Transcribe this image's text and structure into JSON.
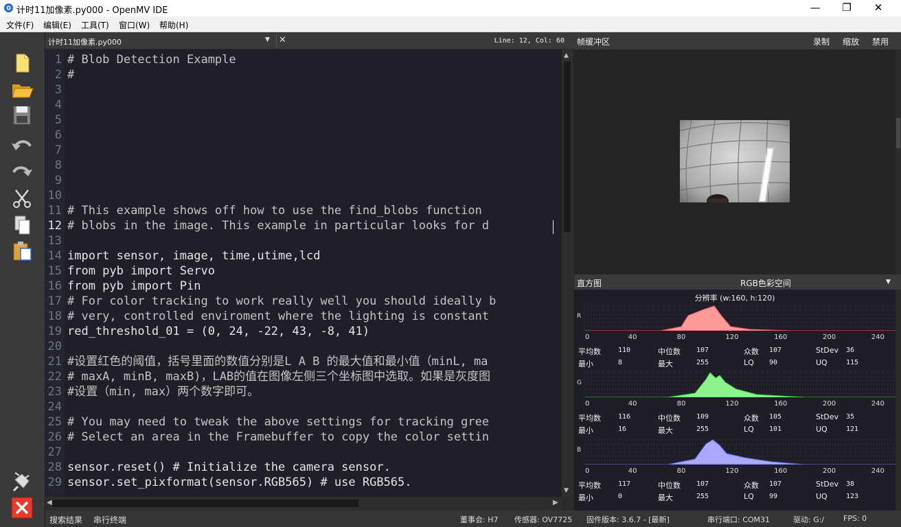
{
  "window": {
    "title": "计时11加像素.py000 - OpenMV IDE",
    "min_glyph": "—",
    "max_glyph": "❐",
    "close_glyph": "✕"
  },
  "menu": [
    "文件(F)",
    "编辑(E)",
    "工具(T)",
    "窗口(W)",
    "帮助(H)"
  ],
  "toolbar": [
    {
      "name": "new-file-icon"
    },
    {
      "name": "open-folder-icon"
    },
    {
      "name": "save-icon"
    },
    {
      "name": "undo-icon"
    },
    {
      "name": "redo-icon"
    },
    {
      "name": "cut-icon"
    },
    {
      "name": "copy-icon"
    },
    {
      "name": "paste-icon"
    },
    {
      "name": "connect-icon"
    },
    {
      "name": "disconnect-icon"
    }
  ],
  "editor": {
    "file_tab": "计时11加像素.py000",
    "position": "Line: 12, Col: 60",
    "current_line": 12,
    "lines": [
      "# Blob Detection Example",
      "#",
      "",
      "",
      "",
      "",
      "",
      "",
      "",
      "",
      "# This example shows off how to use the find_blobs function",
      "# blobs in the image. This example in particular looks for d",
      "",
      "import sensor, image, time,utime,lcd",
      "from pyb import Servo",
      "from pyb import Pin",
      "# For color tracking to work really well you should ideally b",
      "# very, controlled enviroment where the lighting is constant",
      "red_threshold_01 = (0, 24, -22, 43, -8, 41)",
      "",
      "#设置红色的阈值，括号里面的数值分别是L A B 的最大值和最小值（minL, ma",
      "# maxA, minB, maxB)，LAB的值在图像左侧三个坐标图中选取。如果是灰度图",
      "#设置（min, max）两个数字即可。",
      "",
      "# You may need to tweak the above settings for tracking gree",
      "# Select an area in the Framebuffer to copy the color settin",
      "",
      "sensor.reset() # Initialize the camera sensor.",
      "sensor.set_pixformat(sensor.RGB565) # use RGB565."
    ]
  },
  "framebuffer": {
    "title": "帧缓冲区",
    "record": "录制",
    "zoom": "缩放",
    "disable": "禁用"
  },
  "histogram": {
    "title": "直方图",
    "colorspace": "RGB色彩空间",
    "resolution": "分辨率 (w:160, h:120)",
    "ticks": [
      "0",
      "40",
      "80",
      "120",
      "160",
      "200",
      "240"
    ],
    "stat_labels": {
      "mean": "平均数",
      "median": "中位数",
      "mode": "众数",
      "stdev": "StDev",
      "min": "最小",
      "max": "最大",
      "lq": "LQ",
      "uq": "UQ"
    },
    "channels": [
      {
        "name": "R",
        "color": "#ff9a9a",
        "line": "#ff5a5a",
        "mean": "110",
        "median": "107",
        "mode": "107",
        "stdev": "36",
        "min": "8",
        "max": "255",
        "lq": "90",
        "uq": "115"
      },
      {
        "name": "G",
        "color": "#8ef28e",
        "line": "#3ad43a",
        "mean": "116",
        "median": "109",
        "mode": "105",
        "stdev": "35",
        "min": "16",
        "max": "255",
        "lq": "101",
        "uq": "121"
      },
      {
        "name": "B",
        "color": "#a8a8ff",
        "line": "#6a6aff",
        "mean": "117",
        "median": "107",
        "mode": "107",
        "stdev": "38",
        "min": "0",
        "max": "255",
        "lq": "99",
        "uq": "123"
      }
    ]
  },
  "bottom": {
    "search_results": "搜索结果",
    "serial_terminal": "串行终端",
    "board": "董事会: H7",
    "sensor": "传感器: OV7725",
    "firmware": "固件版本: 3.6.7 - [最新]",
    "port": "串行端口: COM31",
    "drive": "驱动: G:/",
    "fps": "FPS: 0"
  }
}
